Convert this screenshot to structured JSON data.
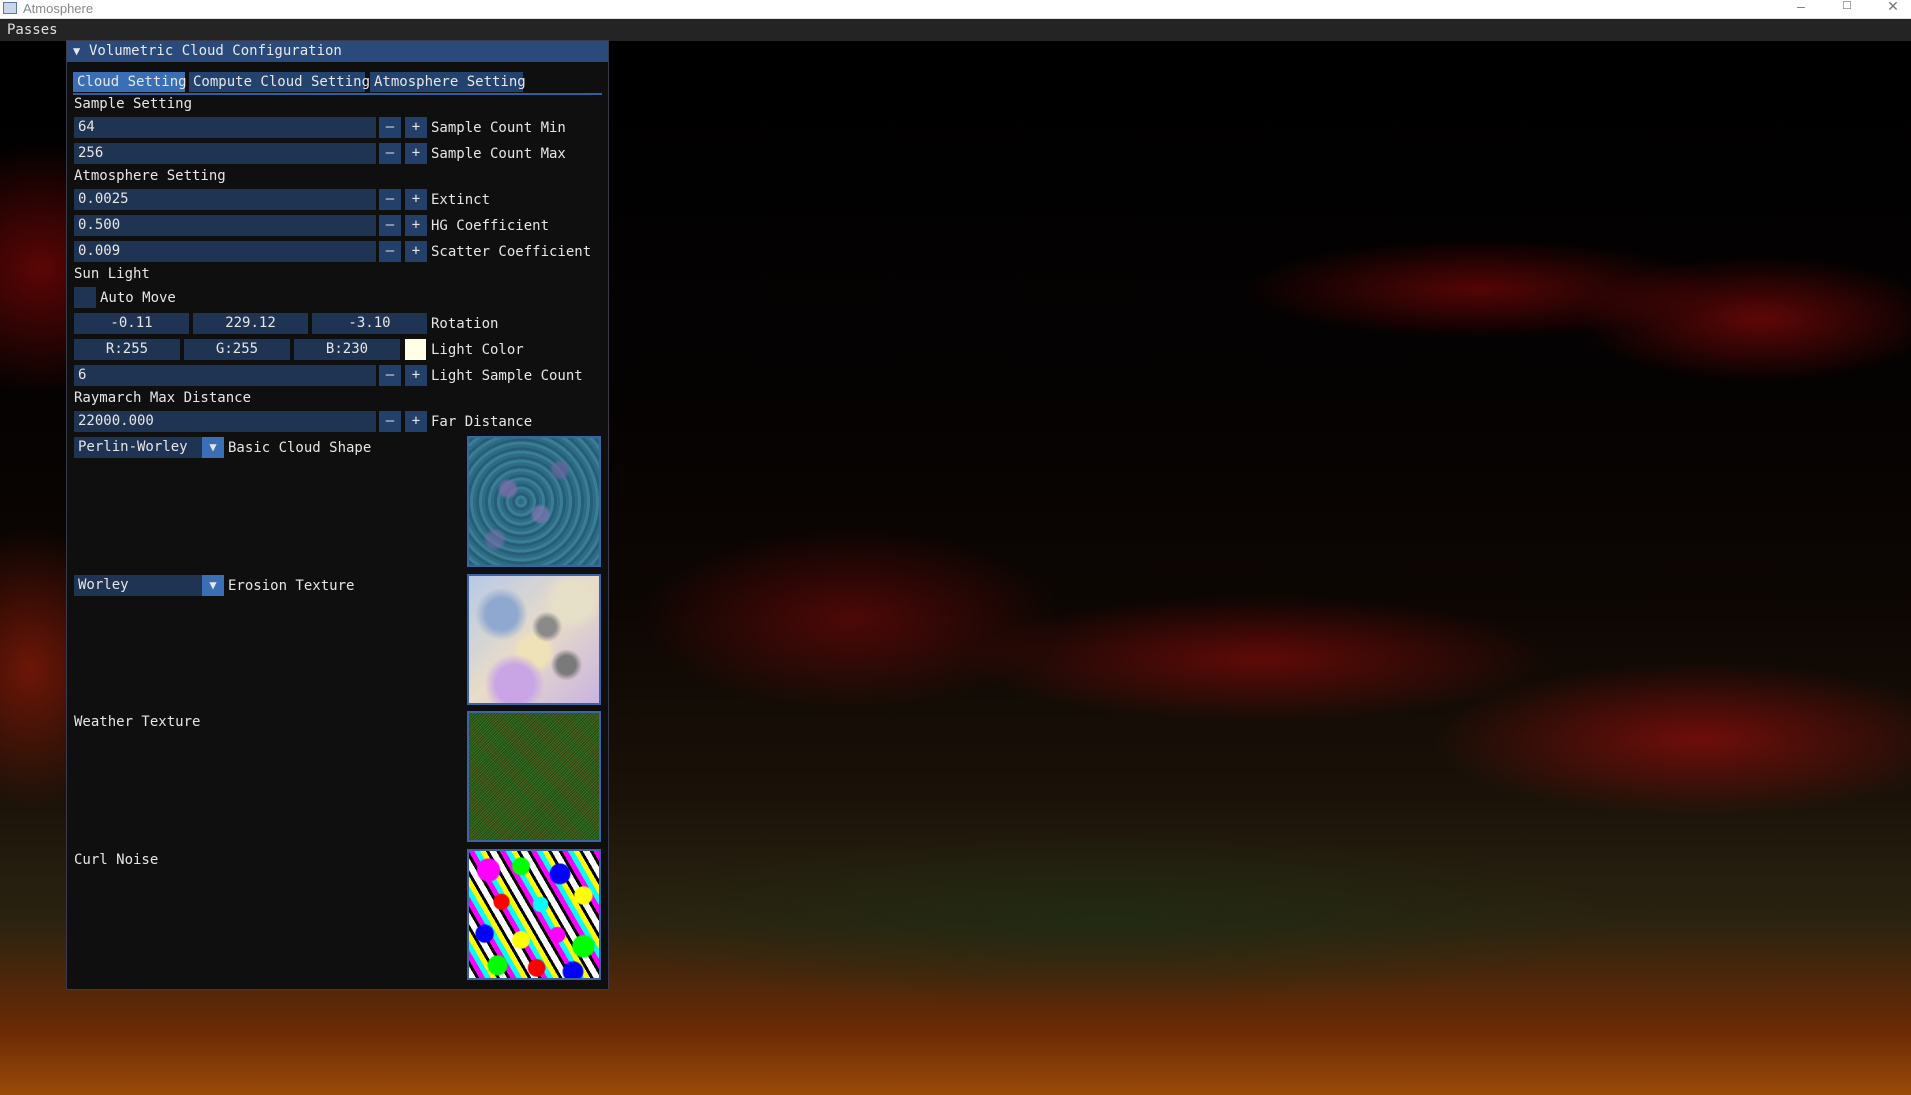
{
  "window": {
    "title": "Atmosphere",
    "minimize": "–",
    "maximize": "☐",
    "close": "✕"
  },
  "menubar": {
    "passes": "Passes"
  },
  "panel": {
    "title": "Volumetric Cloud Configuration",
    "tabs": [
      "Cloud Setting",
      "Compute Cloud Setting",
      "Atmosphere Setting"
    ],
    "sections": {
      "sample": "Sample Setting",
      "atmosphere": "Atmosphere Setting",
      "sun": "Sun Light",
      "raymarch": "Raymarch Max Distance"
    },
    "fields": {
      "sample_min": {
        "value": "64",
        "label": "Sample Count Min"
      },
      "sample_max": {
        "value": "256",
        "label": "Sample Count Max"
      },
      "extinct": {
        "value": "0.0025",
        "label": "Extinct"
      },
      "hg": {
        "value": "0.500",
        "label": "HG Coefficient"
      },
      "scatter": {
        "value": "0.009",
        "label": "Scatter Coefficient"
      },
      "light_samples": {
        "value": "6",
        "label": "Light Sample Count"
      },
      "far": {
        "value": "22000.000",
        "label": "Far Distance"
      }
    },
    "auto_move": {
      "label": "Auto Move",
      "checked": false
    },
    "rotation": {
      "x": "-0.11",
      "y": "229.12",
      "z": "-3.10",
      "label": "Rotation"
    },
    "light_color": {
      "r": "R:255",
      "g": "G:255",
      "b": "B:230",
      "label": "Light Color",
      "swatch": "#ffffe6"
    },
    "minus": "–",
    "plus": "+",
    "basic_cloud": {
      "value": "Perlin-Worley",
      "label": "Basic Cloud Shape"
    },
    "erosion": {
      "value": "Worley",
      "label": "Erosion Texture"
    },
    "weather_label": "Weather Texture",
    "curl_label": "Curl Noise",
    "dropdown_arrow": "▼",
    "collapse_arrow": "▼"
  },
  "colors": {
    "panel_bg": "#0f0f0f",
    "title_bg": "#294a7a",
    "field_bg": "#1f3352",
    "accent": "#3a6fb5"
  }
}
